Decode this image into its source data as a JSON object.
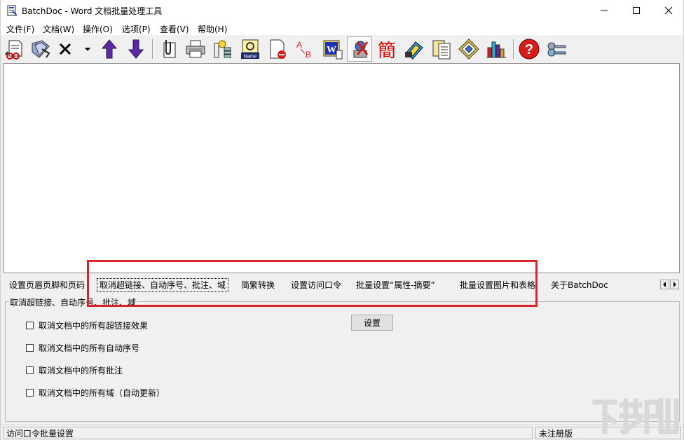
{
  "window": {
    "title": "BatchDoc - Word 文档批量处理工具"
  },
  "menu": [
    "文件(F)",
    "文档(W)",
    "操作(O)",
    "选项(P)",
    "查看(V)",
    "帮助(H)"
  ],
  "toolbar": {
    "icons": [
      "new-file-icon",
      "open-file-icon",
      "delete-icon",
      "dropdown-arrow-icon",
      "move-up-icon",
      "move-down-icon",
      "clip-icon",
      "print-icon",
      "replace-icon",
      "rename-icon",
      "remove-page-icon",
      "ab-replace-icon",
      "word-convert-icon",
      "cancel-link-icon",
      "traditional-icon",
      "password-icon",
      "properties-icon",
      "image-table-icon",
      "statistics-icon",
      "help-icon",
      "register-key-icon"
    ],
    "traditional_glyph": "簡",
    "rename_label": "Name"
  },
  "tabs": [
    "设置页眉页脚和页码",
    "取消超链接、自动序号、批注、域",
    "简繁转换",
    "设置访问口令",
    "批量设置“属性-摘要”",
    "批量设置图片和表格",
    "关于BatchDoc"
  ],
  "active_tab_index": 1,
  "panel": {
    "group_title": "取消超链接、自动序号、批注、域",
    "options": [
      {
        "label": "取消文档中的所有超链接效果",
        "checked": false
      },
      {
        "label": "取消文档中的所有自动序号",
        "checked": false
      },
      {
        "label": "取消文档中的所有批注",
        "checked": false
      },
      {
        "label": "取消文档中的所有域（自动更新）",
        "checked": false
      }
    ],
    "set_button": "设置"
  },
  "status": {
    "left": "访问口令批量设置",
    "right": "未注册版"
  },
  "colors": {
    "highlight_border": "#d7262b",
    "purple_arrow": "#5b2aa0",
    "traditional_red": "#e00000"
  }
}
